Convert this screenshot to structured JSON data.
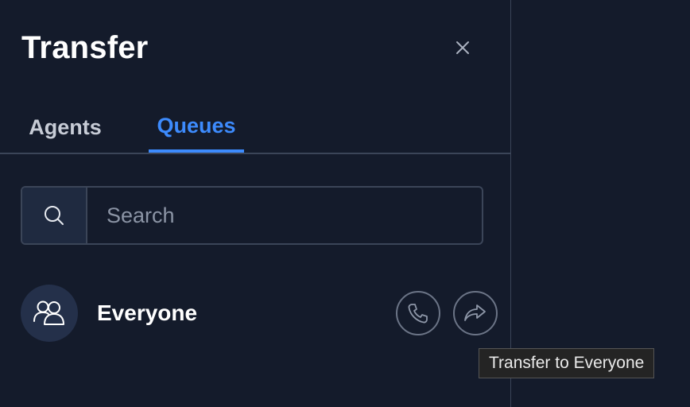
{
  "panel": {
    "title": "Transfer"
  },
  "tabs": [
    {
      "label": "Agents",
      "active": false
    },
    {
      "label": "Queues",
      "active": true
    }
  ],
  "search": {
    "placeholder": "Search",
    "value": ""
  },
  "queues": [
    {
      "name": "Everyone",
      "icon": "group-icon",
      "actions": [
        "phone-icon",
        "share-forward-icon"
      ]
    }
  ],
  "tooltip": {
    "text": "Transfer to Everyone"
  },
  "colors": {
    "background": "#141b2b",
    "accent": "#3d8bfd",
    "border": "#3b4558"
  }
}
